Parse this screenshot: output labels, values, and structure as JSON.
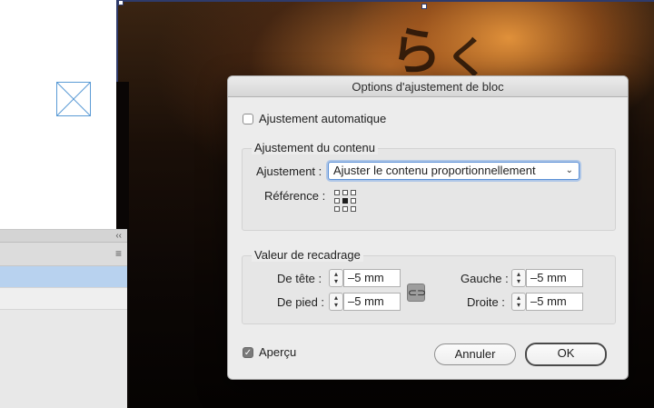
{
  "dialog": {
    "title": "Options d'ajustement de bloc",
    "auto_fit_label": "Ajustement automatique",
    "auto_fit_checked": false,
    "content_fitting": {
      "group_title": "Ajustement du contenu",
      "fitting_label": "Ajustement :",
      "fitting_value": "Ajuster le contenu proportionnellement",
      "reference_label": "Référence :",
      "reference_point": "center"
    },
    "crop": {
      "group_title": "Valeur de recadrage",
      "top_label": "De tête :",
      "top_value": "–5 mm",
      "bottom_label": "De pied :",
      "bottom_value": "–5 mm",
      "left_label": "Gauche :",
      "left_value": "–5 mm",
      "right_label": "Droite :",
      "right_value": "–5 mm",
      "link_icon": "chain-link-icon"
    },
    "preview_label": "Aperçu",
    "preview_checked": true,
    "cancel_label": "Annuler",
    "ok_label": "OK"
  },
  "panel": {
    "collapse_icon": "double-chevron-left-icon",
    "menu_icon": "hamburger-menu-icon"
  },
  "icons": {
    "placeholder": "empty-frame-icon",
    "stepper": "up-down-stepper-icon",
    "dropdown": "chevron-down-icon"
  },
  "colors": {
    "selection_blue": "#b8d2ef",
    "focus_ring": "#5a8fd6",
    "frame_edge": "#2f3b6b"
  }
}
